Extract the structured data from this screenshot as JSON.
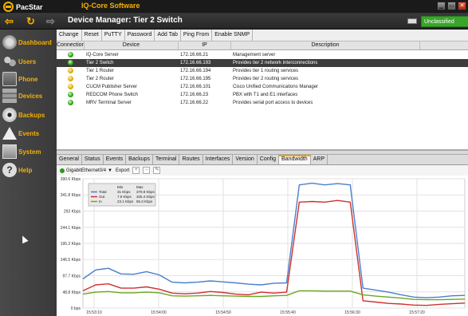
{
  "titlebar": {
    "logo_text": "PacStar",
    "app_name": "IQ-Core Software",
    "win_minimize": "▁",
    "win_maximize": "▭",
    "win_close": "✕"
  },
  "navbar": {
    "back_glyph": "⇦",
    "refresh_glyph": "↻",
    "forward_glyph": "⇨",
    "title": "Device Manager: Tier 2 Switch",
    "classification": "Unclassified"
  },
  "sidebar": {
    "items": [
      {
        "label": "Dashboard",
        "icon": "dashboard-icon"
      },
      {
        "label": "Users",
        "icon": "users-icon"
      },
      {
        "label": "Phone",
        "icon": "phone-icon"
      },
      {
        "label": "Devices",
        "icon": "devices-icon"
      },
      {
        "label": "Backups",
        "icon": "backups-icon"
      },
      {
        "label": "Events",
        "icon": "events-icon"
      },
      {
        "label": "System",
        "icon": "system-icon"
      },
      {
        "label": "Help",
        "icon": "help-icon",
        "glyph": "?"
      }
    ]
  },
  "toolbar": {
    "change": "Change",
    "reset": "Reset",
    "putty": "PuTTY",
    "password": "Password",
    "add_tab": "Add Tab",
    "ping_from": "Ping From",
    "enable_snmp": "Enable SNMP"
  },
  "device_table": {
    "headers": [
      "Connection",
      "Device",
      "IP",
      "Description"
    ],
    "rows": [
      {
        "status": "green",
        "device": "IQ-Core Server",
        "ip": "172.16.66.21",
        "description": "Management server"
      },
      {
        "status": "green",
        "device": "Tier 2 Switch",
        "ip": "172.16.66.193",
        "description": "Provides tier 2 network interconnections",
        "selected": true
      },
      {
        "status": "yellow",
        "device": "Tier 1 Router",
        "ip": "172.16.66.194",
        "description": "Provides tier 1 routing services"
      },
      {
        "status": "yellow",
        "device": "Tier 2 Router",
        "ip": "172.16.66.195",
        "description": "Provides tier 2 routing services"
      },
      {
        "status": "yellow",
        "device": "CUCM Publisher Server",
        "ip": "172.16.66.101",
        "description": "Cisco Unified Communications Manager"
      },
      {
        "status": "green",
        "device": "REDCOM Phone Switch",
        "ip": "172.16.66.23",
        "description": "PBX with T1 and E1 interfaces"
      },
      {
        "status": "green",
        "device": "MRV Terminal Server",
        "ip": "172.16.66.22",
        "description": "Provides serial port access to devices"
      }
    ]
  },
  "tabs": [
    "General",
    "Status",
    "Events",
    "Backups",
    "Terminal",
    "Routes",
    "Interfaces",
    "Version",
    "Config",
    "Bandwidth",
    "ARP"
  ],
  "active_tab": "Bandwidth",
  "chart_toolbar": {
    "interface": "GigabitEthernet0/4",
    "dropdown_glyph": "▼",
    "export": "Export",
    "zoom_in_glyph": "+",
    "zoom_out_glyph": "−",
    "edit_glyph": "✎"
  },
  "colors": {
    "accent": "#f5b000",
    "total": "#4a7fc9",
    "out": "#d03030",
    "in": "#6aa820"
  },
  "chart_data": {
    "type": "line",
    "ylim": [
      0,
      390.6
    ],
    "y_ticks": [
      "390.6 Kbps",
      "341.8 Kbps",
      "293 Kbps",
      "244.1 Kbps",
      "195.3 Kbps",
      "146.5 Kbps",
      "97.7 Kbps",
      "48.8 Kbps",
      "0 bps"
    ],
    "y_tick_values": [
      390.6,
      341.8,
      293,
      244.1,
      195.3,
      146.5,
      97.7,
      48.8,
      0
    ],
    "x_ticks": [
      "15:53:10",
      "15:54:00",
      "15:54:50",
      "15:55:40",
      "15:56:30",
      "15:57:20"
    ],
    "legend": {
      "headers": [
        "",
        "Min",
        "Max"
      ],
      "rows": [
        {
          "name": "Total",
          "min": "31 Kbps",
          "max": "379.8 Kbps"
        },
        {
          "name": "Out",
          "min": "7.9 Kbps",
          "max": "325.4 Kbps"
        },
        {
          "name": "In",
          "min": "23.1 Kbps",
          "max": "55.3 Kbps"
        }
      ]
    },
    "series": [
      {
        "name": "Total",
        "color": "#4a7fc9",
        "values": [
          88,
          115,
          120,
          103,
          102,
          110,
          100,
          78,
          76,
          78,
          82,
          79,
          76,
          72,
          70,
          75,
          76,
          372,
          377,
          372,
          376,
          372,
          60,
          54,
          48,
          40,
          33,
          31,
          33,
          37,
          38
        ]
      },
      {
        "name": "Out",
        "color": "#d03030",
        "values": [
          52,
          70,
          73,
          60,
          60,
          64,
          57,
          45,
          43,
          45,
          50,
          47,
          42,
          40,
          48,
          45,
          48,
          320,
          322,
          320,
          325,
          320,
          22,
          18,
          14,
          12,
          9,
          8,
          11,
          13,
          15
        ]
      },
      {
        "name": "In",
        "color": "#6aa820",
        "values": [
          42,
          48,
          50,
          46,
          46,
          48,
          46,
          37,
          36,
          37,
          38,
          37,
          36,
          35,
          35,
          37,
          38,
          52,
          52,
          51,
          51,
          51,
          40,
          36,
          33,
          30,
          26,
          25,
          25,
          26,
          27
        ]
      }
    ]
  }
}
